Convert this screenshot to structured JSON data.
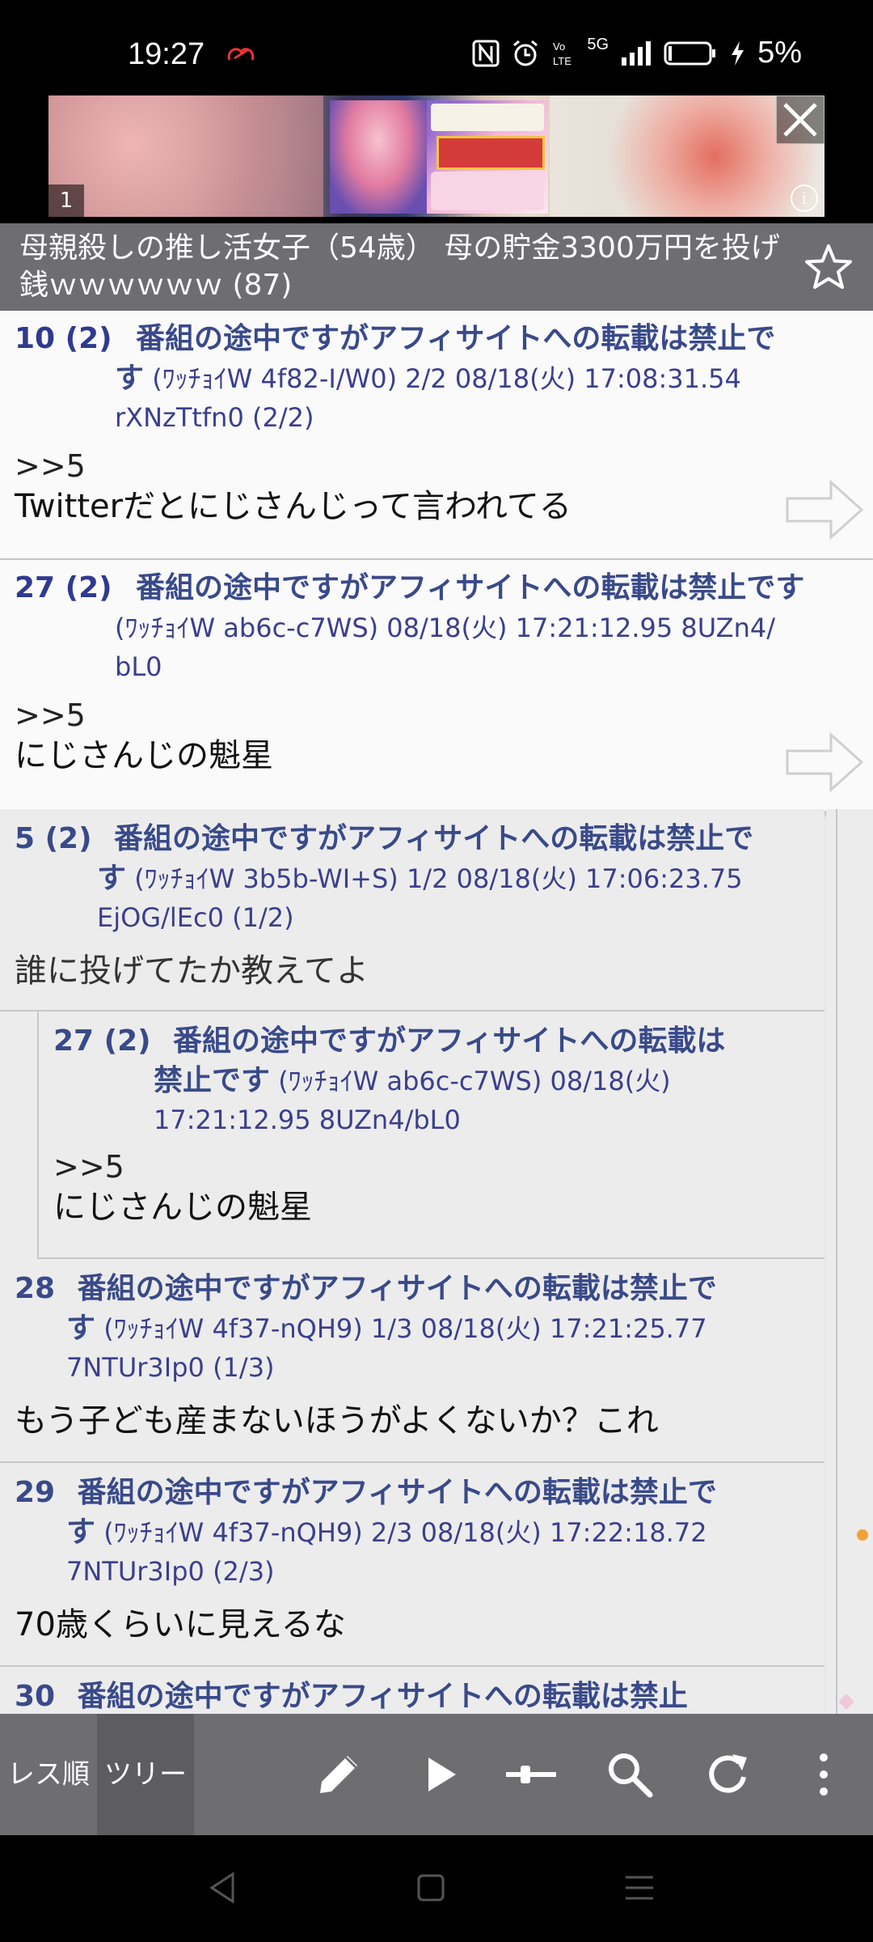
{
  "status": {
    "time": "19:27",
    "battery": "5%",
    "network": "5G"
  },
  "ad": {
    "counter": "1",
    "info_label": "i"
  },
  "thread": {
    "title": "母親殺しの推し活女子（54歳） 母の貯金3300万円を投げ銭ｗｗｗｗｗｗ (87)"
  },
  "popups": [
    {
      "num": "10 (2)",
      "name_a": "番組の途中ですがアフィサイトへの転載は禁止で",
      "name_b": "す",
      "meta": " (ﾜｯﾁｮｲW 4f82-I/W0) 2/2  08/18(火) 17:08:31.54",
      "id": "rXNzTtfn0 (2/2)",
      "anchor": ">>5",
      "text": "Twitterだとにじさんじって言われてる"
    },
    {
      "num": "27 (2)",
      "name_a": "番組の途中ですがアフィサイトへの転載は禁止です",
      "name_b": "",
      "meta": "(ﾜｯﾁｮｲW ab6c-c7WS)  08/18(火) 17:21:12.95 8UZn4/",
      "id": "bL0",
      "anchor": ">>5",
      "text": "にじさんじの魁星"
    }
  ],
  "posts": [
    {
      "num": "5 (2)",
      "name_a": "番組の途中ですがアフィサイトへの転載は禁止で",
      "name_b": "す",
      "meta": " (ﾜｯﾁｮｲW 3b5b-WI+S) 1/2  08/18(火) 17:06:23.75",
      "id": "EjOG/lEc0 (1/2)",
      "anchor": "",
      "text": "誰に投げてたか教えてよ"
    },
    {
      "num": "27 (2)",
      "name_a": "番組の途中ですがアフィサイトへの転載は",
      "name_b": "禁止です",
      "meta": " (ﾜｯﾁｮｲW ab6c-c7WS)  08/18(火)",
      "id": "17:21:12.95 8UZn4/bL0",
      "anchor": ">>5",
      "text": "にじさんじの魁星"
    },
    {
      "num": "28",
      "name_a": "番組の途中ですがアフィサイトへの転載は禁止で",
      "name_b": "す",
      "meta": " (ﾜｯﾁｮｲW 4f37-nQH9) 1/3  08/18(火) 17:21:25.77",
      "id": "7NTUr3Ip0 (1/3)",
      "anchor": "",
      "text": "もう子ども産まないほうがよくないか？これ"
    },
    {
      "num": "29",
      "name_a": "番組の途中ですがアフィサイトへの転載は禁止で",
      "name_b": "す",
      "meta": " (ﾜｯﾁｮｲW 4f37-nQH9) 2/3  08/18(火) 17:22:18.72",
      "id": "7NTUr3Ip0 (2/3)",
      "anchor": "",
      "text": "70歳くらいに見えるな"
    },
    {
      "num": "30",
      "name_a": "番組の途中ですがアフィサイトへの転載は禁止",
      "name_b": "",
      "meta": "",
      "id": "",
      "anchor": "",
      "text": ""
    }
  ],
  "toolbar": {
    "tab_order": "レス順",
    "tab_tree": "ツリー"
  },
  "colors": {
    "bar": "#6e6e70",
    "name": "#394a8a",
    "scroll_dot_orange": "#f2a23a",
    "scroll_dot_pink": "#f0c8d8"
  }
}
